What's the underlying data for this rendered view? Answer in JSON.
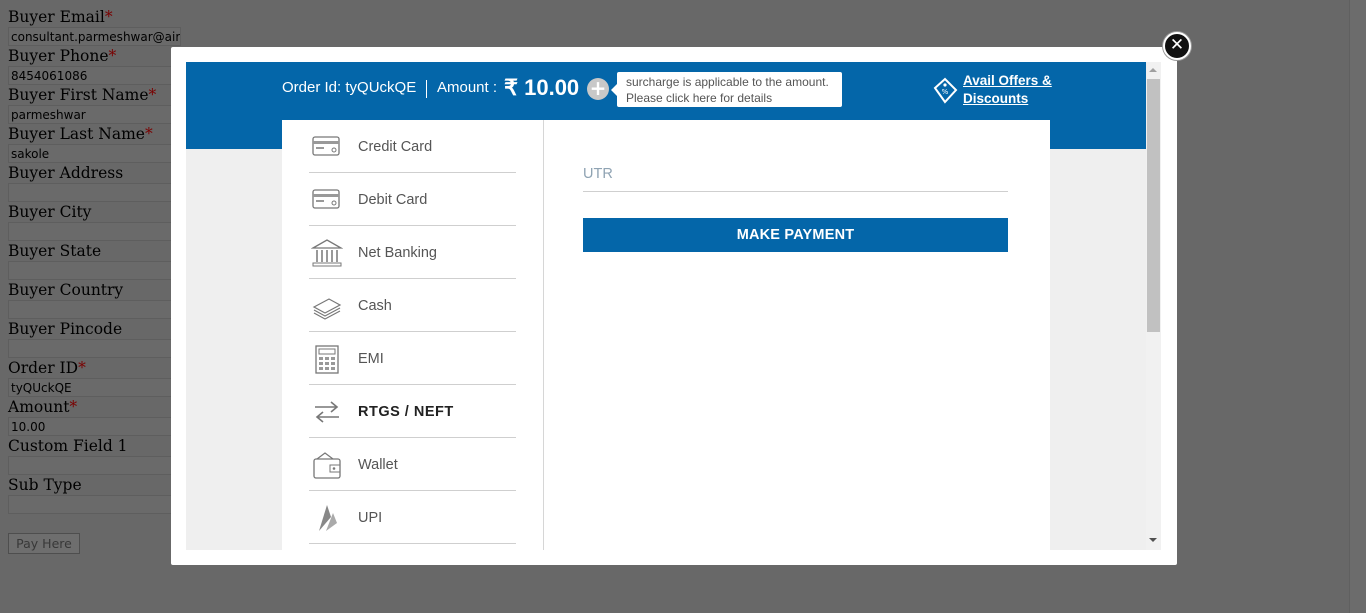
{
  "background_form": {
    "fields": [
      {
        "label": "Buyer Email",
        "required": true,
        "value": "consultant.parmeshwar@airp"
      },
      {
        "label": "Buyer Phone",
        "required": true,
        "value": "8454061086"
      },
      {
        "label": "Buyer First Name",
        "required": true,
        "value": "parmeshwar"
      },
      {
        "label": "Buyer Last Name",
        "required": true,
        "value": "sakole"
      },
      {
        "label": "Buyer Address",
        "required": false,
        "value": ""
      },
      {
        "label": "Buyer City",
        "required": false,
        "value": ""
      },
      {
        "label": "Buyer State",
        "required": false,
        "value": ""
      },
      {
        "label": "Buyer Country",
        "required": false,
        "value": ""
      },
      {
        "label": "Buyer Pincode",
        "required": false,
        "value": ""
      },
      {
        "label": "Order ID",
        "required": true,
        "value": "tyQUckQE"
      },
      {
        "label": "Amount",
        "required": true,
        "value": "10.00"
      },
      {
        "label": "Custom Field 1",
        "required": false,
        "value": ""
      },
      {
        "label": "Sub Type",
        "required": false,
        "value": ""
      }
    ],
    "required_mark": "*",
    "pay_button": "Pay Here"
  },
  "modal": {
    "header": {
      "order_id_text": "Order Id: tyQUckQE",
      "amount_label": "Amount :",
      "amount_value": "₹ 10.00",
      "tooltip_text": "surcharge is applicable to the amount. Please click here for details",
      "offers_line1": "Avail Offers &",
      "offers_line2": "Discounts"
    },
    "payment_methods": [
      {
        "label": "Credit Card",
        "icon": "credit-card-icon"
      },
      {
        "label": "Debit Card",
        "icon": "debit-card-icon"
      },
      {
        "label": "Net Banking",
        "icon": "bank-icon"
      },
      {
        "label": "Cash",
        "icon": "cash-icon"
      },
      {
        "label": "EMI",
        "icon": "calculator-icon"
      },
      {
        "label": "RTGS / NEFT",
        "icon": "transfer-icon",
        "active": true
      },
      {
        "label": "Wallet",
        "icon": "wallet-icon"
      },
      {
        "label": "UPI",
        "icon": "upi-icon"
      }
    ],
    "utr_placeholder": "UTR",
    "utr_value": "",
    "make_payment_label": "MAKE PAYMENT"
  },
  "colors": {
    "brand_blue": "#0466a9",
    "overlay": "#686868"
  }
}
